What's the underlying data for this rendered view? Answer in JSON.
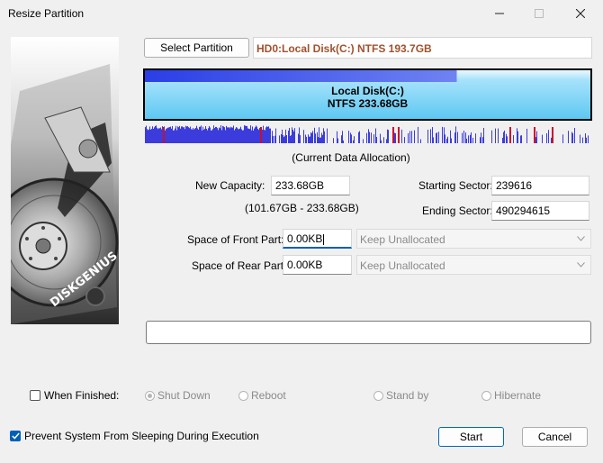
{
  "window": {
    "title": "Resize Partition"
  },
  "select_partition_label": "Select Partition",
  "partition_path": "HD0:Local Disk(C:) NTFS 193.7GB",
  "disk_bar": {
    "name": "Local Disk(C:)",
    "detail": "NTFS 233.68GB",
    "used_fraction": 0.7
  },
  "allocation_caption": "(Current Data Allocation)",
  "new_capacity": {
    "label": "New Capacity:",
    "value": "233.68GB",
    "range": "(101.67GB - 233.68GB)"
  },
  "starting_sector": {
    "label": "Starting Sector:",
    "value": "239616"
  },
  "ending_sector": {
    "label": "Ending Sector:",
    "value": "490294615"
  },
  "front_space": {
    "label": "Space of Front Part:",
    "value": "0.00KB",
    "mode": "Keep Unallocated"
  },
  "rear_space": {
    "label": "Space of Rear Part:",
    "value": "0.00KB",
    "mode": "Keep Unallocated"
  },
  "progress_value": 0,
  "when_finished": {
    "label": "When Finished:",
    "checked": false,
    "options": [
      "Shut Down",
      "Reboot",
      "Stand by",
      "Hibernate"
    ],
    "selected": "Shut Down"
  },
  "prevent_sleep": {
    "label": "Prevent System From Sleeping During Execution",
    "checked": true
  },
  "start_label": "Start",
  "cancel_label": "Cancel",
  "sidebar_brand": "DISKGENIUS",
  "colors": {
    "accent": "#005fb8",
    "path_text": "#a0522d",
    "bar_fill": "#7ed3f7",
    "alloc_used": "#3c3cdc",
    "alloc_marker": "#c8102e"
  }
}
